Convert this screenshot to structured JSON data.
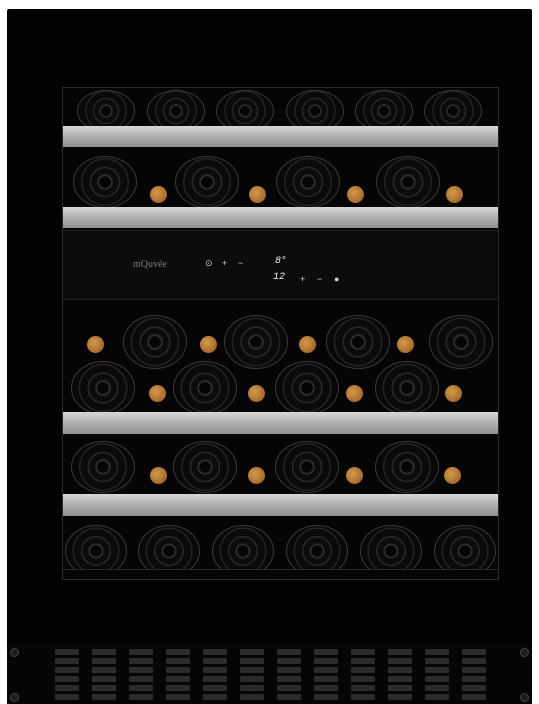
{
  "brand": "mQuvée",
  "upper_zone": {
    "temperature": "8°",
    "controls": [
      "⊙",
      "+",
      "−"
    ]
  },
  "lower_zone": {
    "temperature": "12",
    "controls": [
      "+",
      "−",
      "●"
    ]
  },
  "colors": {
    "cabinet": "#020202",
    "shelf": "#c8c8c8",
    "cork": "#b5762f",
    "display_text": "#f0f0f0"
  }
}
